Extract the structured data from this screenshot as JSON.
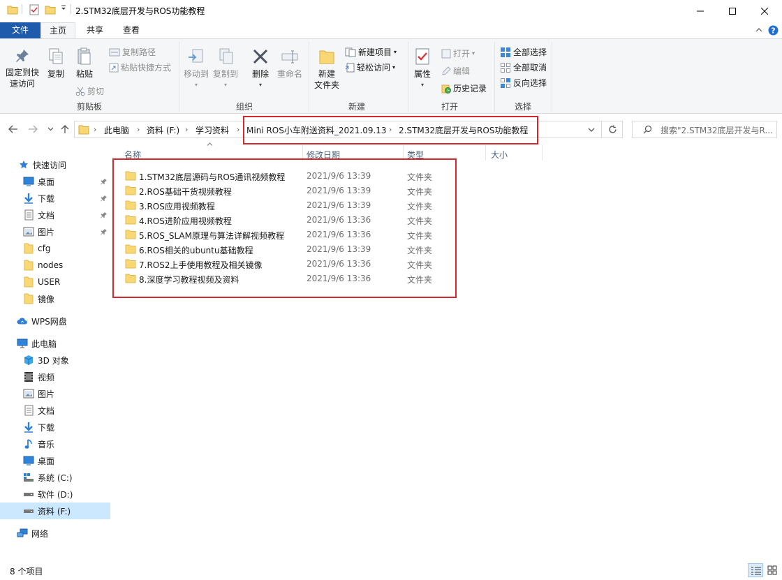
{
  "window": {
    "title": "2.STM32底层开发与ROS功能教程",
    "minimize_icon": "minimize-icon",
    "maximize_icon": "maximize-icon",
    "close_icon": "close-icon"
  },
  "ribbon_tabs": [
    {
      "label": "文件"
    },
    {
      "label": "主页"
    },
    {
      "label": "共享"
    },
    {
      "label": "查看"
    }
  ],
  "ribbon": {
    "clipboard": {
      "group_label": "剪贴板",
      "pin_quick_l1": "固定到快",
      "pin_quick_l2": "速访问",
      "copy": "复制",
      "paste": "粘贴",
      "copy_path": "复制路径",
      "paste_shortcut": "粘贴快捷方式",
      "cut": "剪切"
    },
    "organize": {
      "group_label": "组织",
      "move_to": "移动到",
      "copy_to": "复制到",
      "delete": "删除",
      "rename": "重命名"
    },
    "new": {
      "group_label": "新建",
      "new_folder_l1": "新建",
      "new_folder_l2": "文件夹",
      "new_item": "新建项目",
      "easy_access": "轻松访问"
    },
    "open": {
      "group_label": "打开",
      "properties": "属性",
      "open": "打开",
      "edit": "编辑",
      "history": "历史记录"
    },
    "select": {
      "group_label": "选择",
      "select_all": "全部选择",
      "select_none": "全部取消",
      "invert": "反向选择"
    }
  },
  "address": {
    "crumbs": [
      "此电脑",
      "资料 (F:)",
      "学习资料",
      "Mini ROS小车附送资料_2021.09.13",
      "2.STM32底层开发与ROS功能教程"
    ],
    "search_placeholder": "搜索\"2.STM32底层开发与R..."
  },
  "nav": {
    "quick_access": "快速访问",
    "quick_items": [
      {
        "label": "桌面",
        "icon": "desktop-icon",
        "pinned": true
      },
      {
        "label": "下载",
        "icon": "download-icon",
        "pinned": true
      },
      {
        "label": "文档",
        "icon": "documents-icon",
        "pinned": true
      },
      {
        "label": "图片",
        "icon": "pictures-icon",
        "pinned": true
      },
      {
        "label": "cfg",
        "icon": "folder-icon",
        "pinned": false
      },
      {
        "label": "nodes",
        "icon": "folder-icon",
        "pinned": false
      },
      {
        "label": "USER",
        "icon": "folder-icon",
        "pinned": false
      },
      {
        "label": "镜像",
        "icon": "folder-icon",
        "pinned": false
      }
    ],
    "wps": "WPS网盘",
    "this_pc": "此电脑",
    "pc_items": [
      {
        "label": "3D 对象",
        "icon": "3d-objects-icon"
      },
      {
        "label": "视频",
        "icon": "videos-icon"
      },
      {
        "label": "图片",
        "icon": "pictures-icon"
      },
      {
        "label": "文档",
        "icon": "documents-icon"
      },
      {
        "label": "下载",
        "icon": "download-icon"
      },
      {
        "label": "音乐",
        "icon": "music-icon"
      },
      {
        "label": "桌面",
        "icon": "desktop-icon"
      },
      {
        "label": "系统 (C:)",
        "icon": "system-drive-icon"
      },
      {
        "label": "软件 (D:)",
        "icon": "drive-icon"
      },
      {
        "label": "资料 (F:)",
        "icon": "drive-icon",
        "selected": true
      }
    ],
    "network": "网络"
  },
  "columns": {
    "name": "名称",
    "modified": "修改日期",
    "type": "类型",
    "size": "大小"
  },
  "files": [
    {
      "name": "1.STM32底层源码与ROS通讯视频教程",
      "modified": "2021/9/6 13:39",
      "type": "文件夹"
    },
    {
      "name": "2.ROS基础干货视频教程",
      "modified": "2021/9/6 13:39",
      "type": "文件夹"
    },
    {
      "name": "3.ROS应用视频教程",
      "modified": "2021/9/6 13:39",
      "type": "文件夹"
    },
    {
      "name": "4.ROS进阶应用视频教程",
      "modified": "2021/9/6 13:36",
      "type": "文件夹"
    },
    {
      "name": "5.ROS_SLAM原理与算法详解视频教程",
      "modified": "2021/9/6 13:36",
      "type": "文件夹"
    },
    {
      "name": "6.ROS相关的ubuntu基础教程",
      "modified": "2021/9/6 13:39",
      "type": "文件夹"
    },
    {
      "name": "7.ROS2上手使用教程及相关镜像",
      "modified": "2021/9/6 13:36",
      "type": "文件夹"
    },
    {
      "name": "8.深度学习教程视频及资料",
      "modified": "2021/9/6 13:36",
      "type": "文件夹"
    }
  ],
  "status": {
    "item_count": "8 个项目"
  },
  "colors": {
    "accent": "#1f5bac",
    "folder": "#f8d775",
    "highlight_box": "#d5282d",
    "selection": "#cce8ff"
  }
}
